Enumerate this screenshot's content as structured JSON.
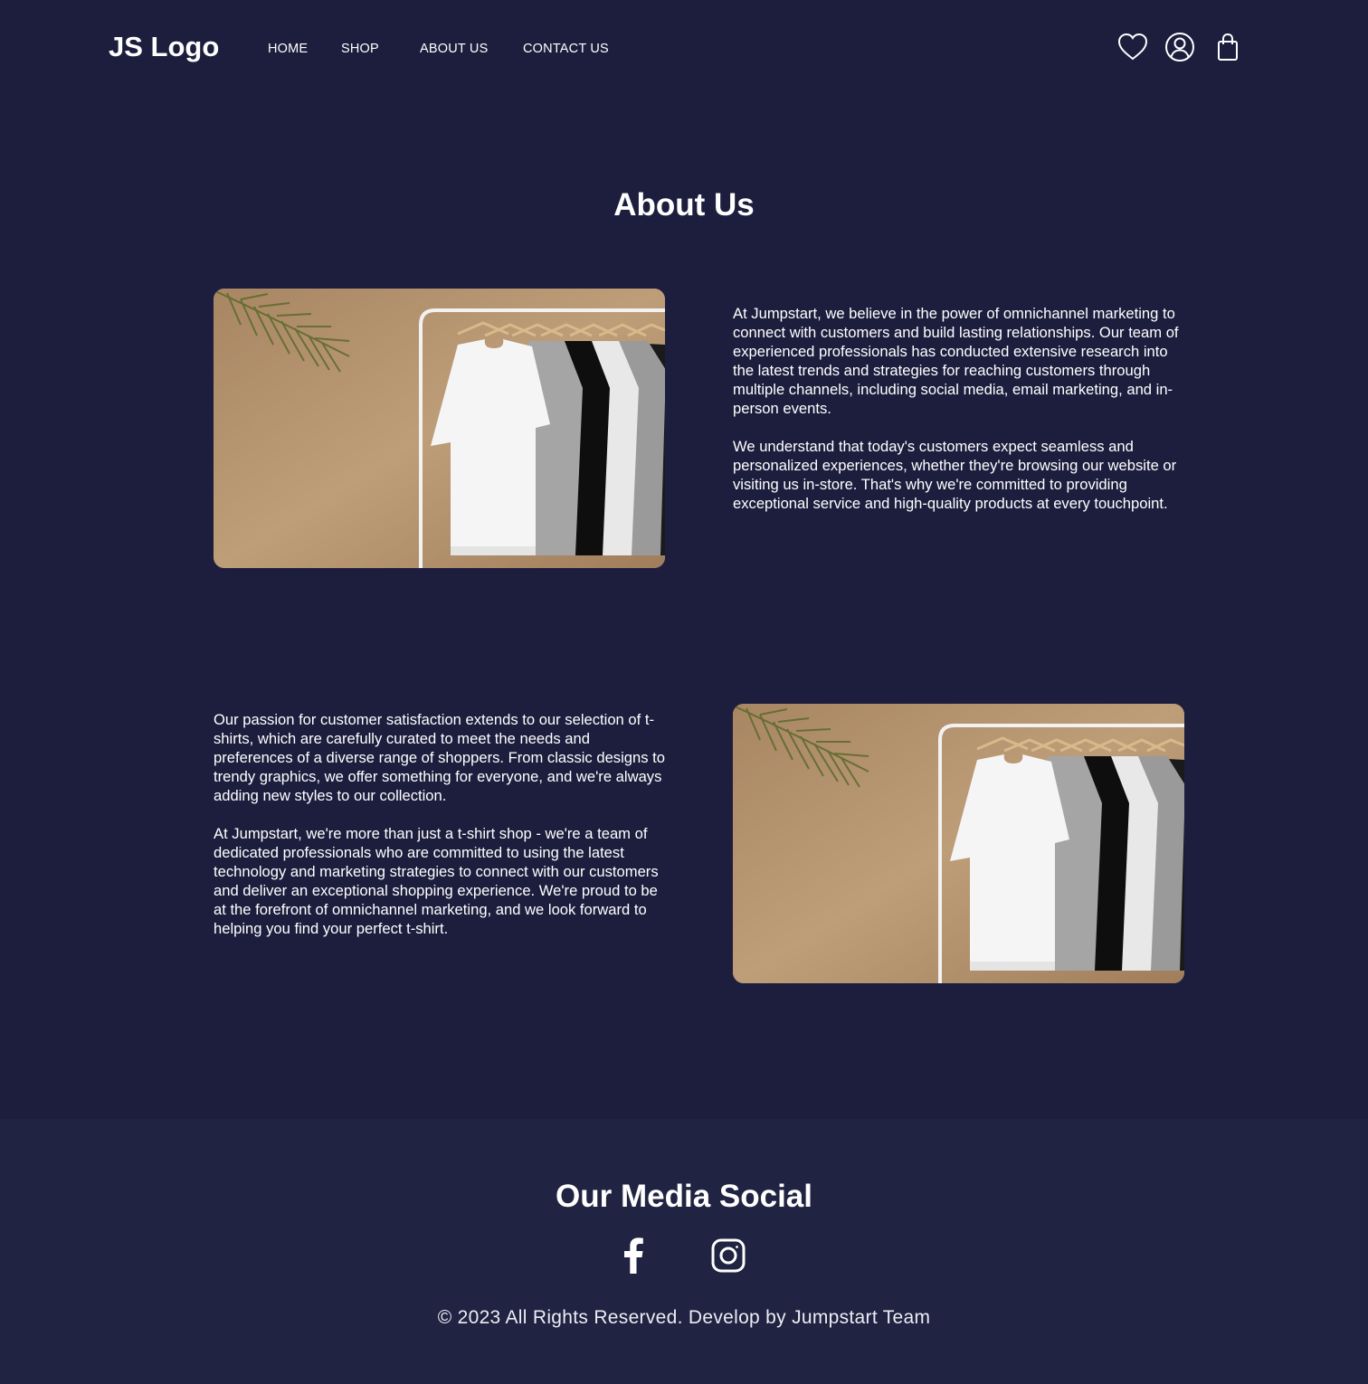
{
  "header": {
    "logo": "JS Logo",
    "menu": [
      {
        "label": "HOME"
      },
      {
        "label": "SHOP"
      },
      {
        "label": "ABOUT US"
      },
      {
        "label": "CONTACT US"
      }
    ],
    "icons": [
      "heart-icon",
      "user-icon",
      "shopping-bag-icon"
    ]
  },
  "about": {
    "title": "About Us",
    "block1": {
      "paragraphs": [
        "At Jumpstart, we believe in the power of omnichannel marketing to connect with customers and build lasting relationships. Our team of experienced professionals has conducted extensive research into the latest trends and strategies for reaching customers through multiple channels, including social media, email marketing, and in-person events.",
        "We understand that today's customers expect seamless and personalized experiences, whether they're browsing our website or visiting us in-store. That's why we're committed to providing exceptional service and high-quality products at every touchpoint."
      ]
    },
    "block2": {
      "paragraphs": [
        "Our passion for customer satisfaction extends to our selection of t-shirts, which are carefully curated to meet the needs and preferences of a diverse range of shoppers. From classic designs to trendy graphics, we offer something for everyone, and we're always adding new styles to our collection.",
        "At Jumpstart, we're more than just a t-shirt shop - we're a team of dedicated professionals who are committed to using the latest technology and marketing strategies to connect with our customers and deliver an exceptional shopping experience. We're proud to be at the forefront of omnichannel marketing, and we look forward to helping you find your perfect t-shirt."
      ]
    }
  },
  "footer": {
    "title": "Our Media Social",
    "social": [
      "facebook-icon",
      "instagram-icon"
    ],
    "copyright": "© 2023 All Rights Reserved. Develop by Jumpstart Team"
  },
  "colors": {
    "background": "#1d1e3e",
    "footer_background": "#202341",
    "text": "#ffffff",
    "photo_wall": "#b18f6c"
  }
}
